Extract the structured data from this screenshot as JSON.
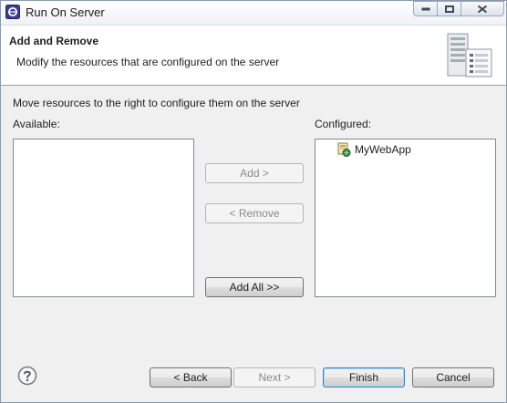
{
  "window": {
    "title": "Run On Server"
  },
  "banner": {
    "title": "Add and Remove",
    "description": "Modify the resources that are configured on the server"
  },
  "body": {
    "instructions": "Move resources to the right to configure them on the server",
    "available_label": "Available:",
    "configured_label": "Configured:",
    "available_items": [],
    "configured_items": [
      {
        "label": "MyWebApp",
        "icon": "web-app-icon"
      }
    ]
  },
  "transfer_buttons": {
    "add": "Add >",
    "remove": "< Remove",
    "add_all": "Add All >>"
  },
  "footer": {
    "back": "< Back",
    "next": "Next >",
    "finish": "Finish",
    "cancel": "Cancel"
  },
  "colors": {
    "window_border": "#8a9aad",
    "dialog_bg": "#f0f0f0",
    "default_button_border": "#3c7fb1",
    "disabled_text": "#8a8a8a"
  }
}
